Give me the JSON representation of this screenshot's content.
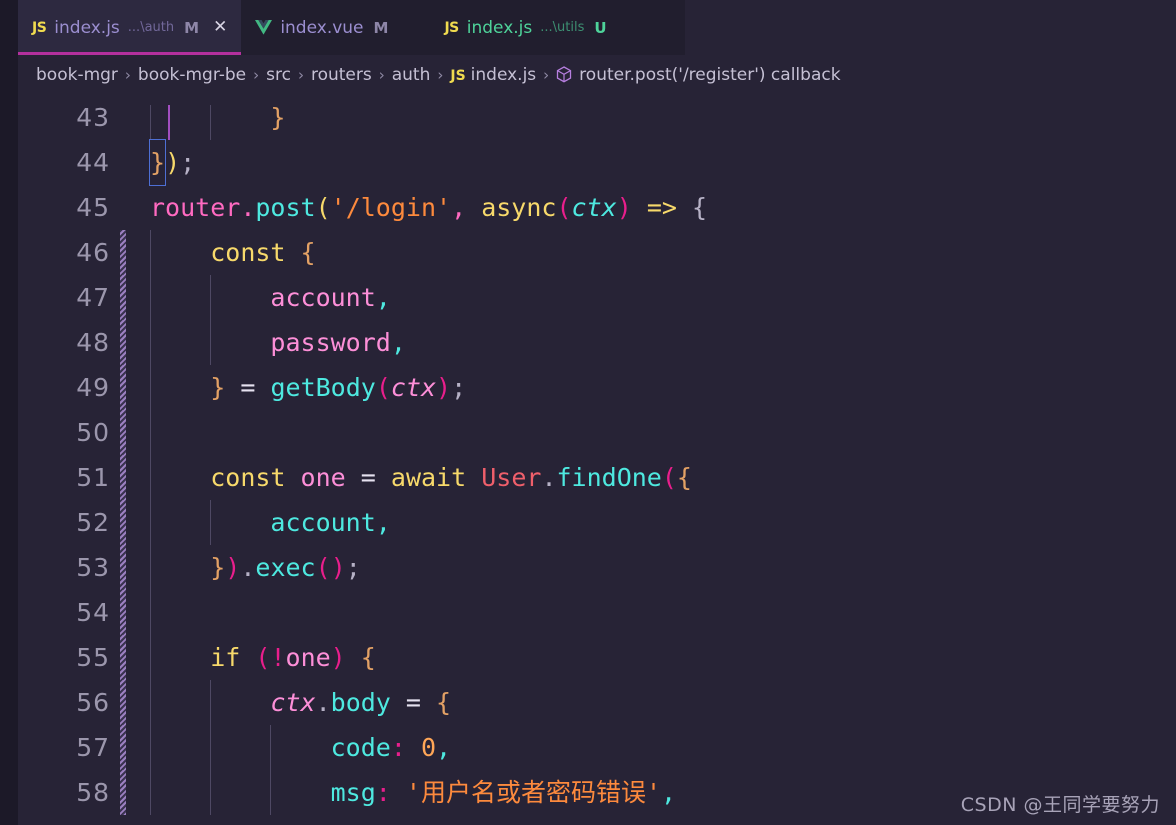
{
  "window": {
    "app": "Visual Studio Code",
    "editor_background": "#272336",
    "tabbar_background": "#211e2e",
    "active_tab_background": "#2d2940",
    "active_tab_border": "#b4309e",
    "linenumber_color": "#9b96ac"
  },
  "tabs": [
    {
      "icon": "js-file-icon",
      "icon_label": "JS",
      "name": "index.js",
      "path": "...\\auth",
      "status": "M",
      "status_title": "Modified",
      "active": true,
      "has_close": true,
      "close_label": "✕",
      "name_color": "#9b8ed0"
    },
    {
      "icon": "vue-file-icon",
      "icon_label": "V",
      "name": "index.vue",
      "path": "",
      "status": "M",
      "status_title": "Modified",
      "active": false,
      "has_close": false,
      "close_label": "",
      "name_color": "#9b8ed0"
    },
    {
      "icon": "js-file-icon",
      "icon_label": "JS",
      "name": "index.js",
      "path": "...\\utils",
      "status": "U",
      "status_title": "Untracked",
      "active": false,
      "has_close": false,
      "close_label": "",
      "name_color": "#4ed39a"
    }
  ],
  "breadcrumb": {
    "separator": "›",
    "items": [
      {
        "label": "book-mgr",
        "icon": ""
      },
      {
        "label": "book-mgr-be",
        "icon": ""
      },
      {
        "label": "src",
        "icon": ""
      },
      {
        "label": "routers",
        "icon": ""
      },
      {
        "label": "auth",
        "icon": ""
      },
      {
        "label": "index.js",
        "icon": "js-file-icon",
        "icon_label": "JS"
      },
      {
        "label": "router.post('/register') callback",
        "icon": "symbol-method-icon"
      }
    ]
  },
  "editor": {
    "language": "JavaScript",
    "first_visible_line": 43,
    "lines": [
      {
        "n": 43,
        "text": "        }"
      },
      {
        "n": 44,
        "text": "});"
      },
      {
        "n": 45,
        "text": "router.post('/login', async(ctx) => {"
      },
      {
        "n": 46,
        "text": "    const {"
      },
      {
        "n": 47,
        "text": "        account,"
      },
      {
        "n": 48,
        "text": "        password,"
      },
      {
        "n": 49,
        "text": "    } = getBody(ctx);"
      },
      {
        "n": 50,
        "text": ""
      },
      {
        "n": 51,
        "text": "    const one = await User.findOne({"
      },
      {
        "n": 52,
        "text": "        account,"
      },
      {
        "n": 53,
        "text": "    }).exec();"
      },
      {
        "n": 54,
        "text": ""
      },
      {
        "n": 55,
        "text": "    if (!one) {"
      },
      {
        "n": 56,
        "text": "        ctx.body = {"
      },
      {
        "n": 57,
        "text": "            code: 0,"
      },
      {
        "n": 58,
        "text": "            msg: '用户名或者密码错误',"
      }
    ],
    "tokens": {
      "l43": [
        {
          "t": "        ",
          "c": "t-white"
        },
        {
          "t": "}",
          "c": "t-gold"
        }
      ],
      "l44": [
        {
          "t": "}",
          "c": "t-gold bracket-match"
        },
        {
          "t": ")",
          "c": "t-yellow"
        },
        {
          "t": ";",
          "c": "t-grey"
        }
      ],
      "l45": [
        {
          "t": "router",
          "c": "t-pink"
        },
        {
          "t": ".",
          "c": "t-pink"
        },
        {
          "t": "post",
          "c": "t-cyan"
        },
        {
          "t": "(",
          "c": "t-yellow"
        },
        {
          "t": "'/login'",
          "c": "t-orange"
        },
        {
          "t": ",",
          "c": "t-pink"
        },
        {
          "t": " ",
          "c": "t-white"
        },
        {
          "t": "async",
          "c": "t-yellow"
        },
        {
          "t": "(",
          "c": "t-magenta"
        },
        {
          "t": "ctx",
          "c": "t-cyan t-italic"
        },
        {
          "t": ")",
          "c": "t-magenta"
        },
        {
          "t": " ",
          "c": "t-white"
        },
        {
          "t": "=>",
          "c": "t-yellow"
        },
        {
          "t": " ",
          "c": "t-white"
        },
        {
          "t": "{",
          "c": "t-grey"
        }
      ],
      "l46": [
        {
          "t": "    ",
          "c": "t-white"
        },
        {
          "t": "const",
          "c": "t-yellow"
        },
        {
          "t": " ",
          "c": "t-white"
        },
        {
          "t": "{",
          "c": "t-gold"
        }
      ],
      "l47": [
        {
          "t": "        ",
          "c": "t-white"
        },
        {
          "t": "account",
          "c": "t-pinklt"
        },
        {
          "t": ",",
          "c": "t-cyan"
        }
      ],
      "l48": [
        {
          "t": "        ",
          "c": "t-white"
        },
        {
          "t": "password",
          "c": "t-pinklt"
        },
        {
          "t": ",",
          "c": "t-cyan"
        }
      ],
      "l49": [
        {
          "t": "    ",
          "c": "t-white"
        },
        {
          "t": "}",
          "c": "t-gold"
        },
        {
          "t": " ",
          "c": "t-white"
        },
        {
          "t": "=",
          "c": "t-white"
        },
        {
          "t": " ",
          "c": "t-white"
        },
        {
          "t": "getBody",
          "c": "t-cyan"
        },
        {
          "t": "(",
          "c": "t-magenta"
        },
        {
          "t": "ctx",
          "c": "t-pinklt t-italic"
        },
        {
          "t": ")",
          "c": "t-magenta"
        },
        {
          "t": ";",
          "c": "t-grey"
        }
      ],
      "l50": [],
      "l51": [
        {
          "t": "    ",
          "c": "t-white"
        },
        {
          "t": "const",
          "c": "t-yellow"
        },
        {
          "t": " ",
          "c": "t-white"
        },
        {
          "t": "one",
          "c": "t-pinklt"
        },
        {
          "t": " ",
          "c": "t-white"
        },
        {
          "t": "=",
          "c": "t-white"
        },
        {
          "t": " ",
          "c": "t-white"
        },
        {
          "t": "await",
          "c": "t-yellow"
        },
        {
          "t": " ",
          "c": "t-white"
        },
        {
          "t": "User",
          "c": "t-salmon"
        },
        {
          "t": ".",
          "c": "t-grey"
        },
        {
          "t": "findOne",
          "c": "t-cyan"
        },
        {
          "t": "(",
          "c": "t-magenta"
        },
        {
          "t": "{",
          "c": "t-gold"
        }
      ],
      "l52": [
        {
          "t": "        ",
          "c": "t-white"
        },
        {
          "t": "account",
          "c": "t-cyan"
        },
        {
          "t": ",",
          "c": "t-cyan"
        }
      ],
      "l53": [
        {
          "t": "    ",
          "c": "t-white"
        },
        {
          "t": "}",
          "c": "t-gold"
        },
        {
          "t": ")",
          "c": "t-magenta"
        },
        {
          "t": ".",
          "c": "t-grey"
        },
        {
          "t": "exec",
          "c": "t-cyan"
        },
        {
          "t": "(",
          "c": "t-magenta"
        },
        {
          "t": ")",
          "c": "t-magenta"
        },
        {
          "t": ";",
          "c": "t-grey"
        }
      ],
      "l54": [],
      "l55": [
        {
          "t": "    ",
          "c": "t-white"
        },
        {
          "t": "if",
          "c": "t-yellow"
        },
        {
          "t": " ",
          "c": "t-white"
        },
        {
          "t": "(",
          "c": "t-magenta"
        },
        {
          "t": "!",
          "c": "t-magenta"
        },
        {
          "t": "one",
          "c": "t-pinklt"
        },
        {
          "t": ")",
          "c": "t-magenta"
        },
        {
          "t": " ",
          "c": "t-white"
        },
        {
          "t": "{",
          "c": "t-gold"
        }
      ],
      "l56": [
        {
          "t": "        ",
          "c": "t-white"
        },
        {
          "t": "ctx",
          "c": "t-pinklt t-italic"
        },
        {
          "t": ".",
          "c": "t-grey"
        },
        {
          "t": "body",
          "c": "t-cyan"
        },
        {
          "t": " ",
          "c": "t-white"
        },
        {
          "t": "=",
          "c": "t-white"
        },
        {
          "t": " ",
          "c": "t-white"
        },
        {
          "t": "{",
          "c": "t-gold"
        }
      ],
      "l57": [
        {
          "t": "            ",
          "c": "t-white"
        },
        {
          "t": "code",
          "c": "t-cyan"
        },
        {
          "t": ":",
          "c": "t-magenta"
        },
        {
          "t": " ",
          "c": "t-white"
        },
        {
          "t": "0",
          "c": "t-orange2"
        },
        {
          "t": ",",
          "c": "t-cyan"
        }
      ],
      "l58": [
        {
          "t": "            ",
          "c": "t-white"
        },
        {
          "t": "msg",
          "c": "t-cyan"
        },
        {
          "t": ":",
          "c": "t-magenta"
        },
        {
          "t": " ",
          "c": "t-white"
        },
        {
          "t": "'用户名或者密码错误'",
          "c": "t-orange"
        },
        {
          "t": ",",
          "c": "t-cyan"
        }
      ]
    },
    "changed_lines": [
      46,
      47,
      48,
      49,
      50,
      51,
      52,
      53,
      54,
      55,
      56,
      57,
      58
    ]
  },
  "watermark": {
    "text": "CSDN @王同学要努力"
  }
}
